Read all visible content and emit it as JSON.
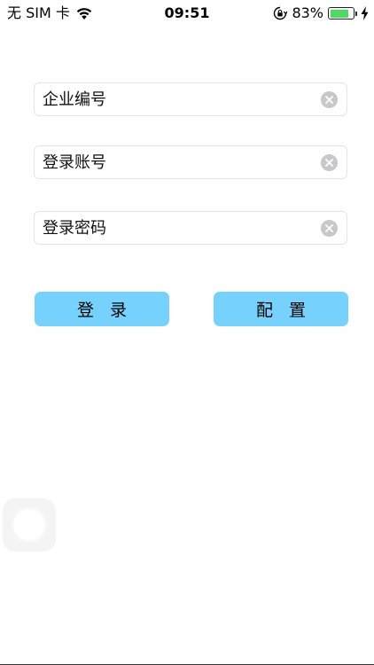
{
  "status_bar": {
    "carrier": "无 SIM 卡",
    "time": "09:51",
    "battery_percent": "83%",
    "battery_level": 0.83,
    "battery_color": "#4cd964"
  },
  "form": {
    "company_id_placeholder": "企业编号",
    "company_id_value": "",
    "account_placeholder": "登录账号",
    "account_value": "",
    "password_placeholder": "登录密码",
    "password_value": ""
  },
  "buttons": {
    "login_label": "登录",
    "config_label": "配置",
    "color": "#76d1fc"
  },
  "icons": {
    "wifi": "wifi-icon",
    "orientation_lock": "orientation-lock-icon",
    "battery": "battery-icon",
    "charging": "charging-bolt-icon",
    "clear": "clear-circle-icon",
    "assistive_touch": "assistive-touch-icon"
  }
}
